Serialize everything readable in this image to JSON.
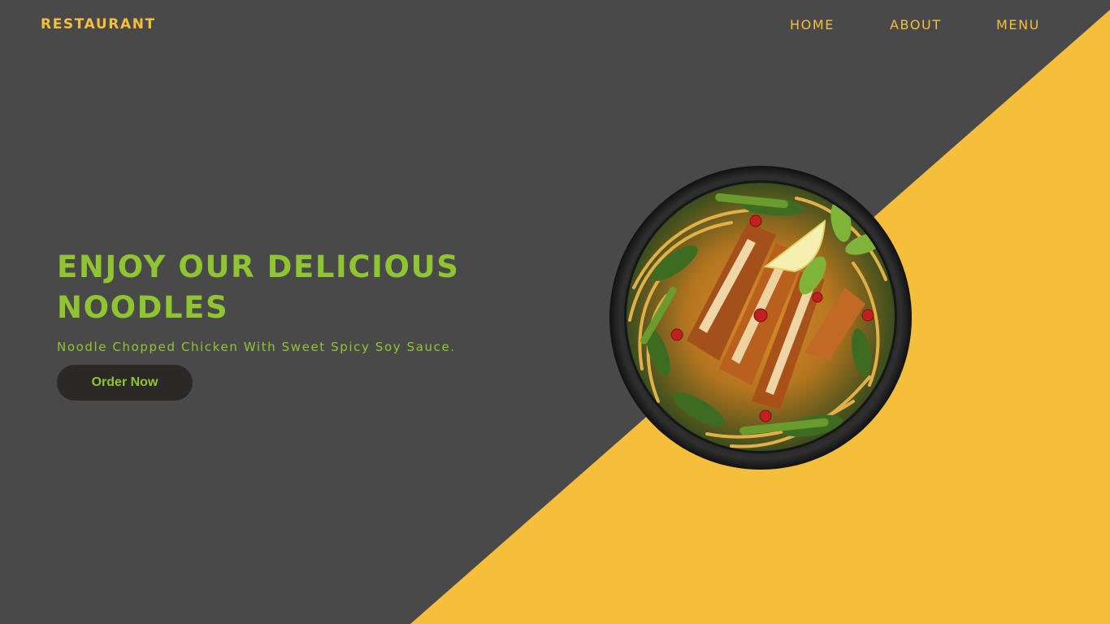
{
  "brand": {
    "name": "RESTAURANT"
  },
  "nav": {
    "items": [
      {
        "label": "HOME"
      },
      {
        "label": "ABOUT"
      },
      {
        "label": "MENU"
      }
    ]
  },
  "hero": {
    "title_line1": "ENJOY OUR DELICIOUS",
    "title_line2": "NOODLES",
    "subtitle": "Noodle Chopped Chicken With Sweet Spicy Soy Sauce.",
    "cta_label": "Order Now"
  },
  "image": {
    "icon": "noodle-bowl-image"
  },
  "colors": {
    "background": "#4a4949",
    "accent_yellow": "#f5bf3c",
    "accent_green": "#8fc531",
    "button_bg": "#2a2928"
  }
}
